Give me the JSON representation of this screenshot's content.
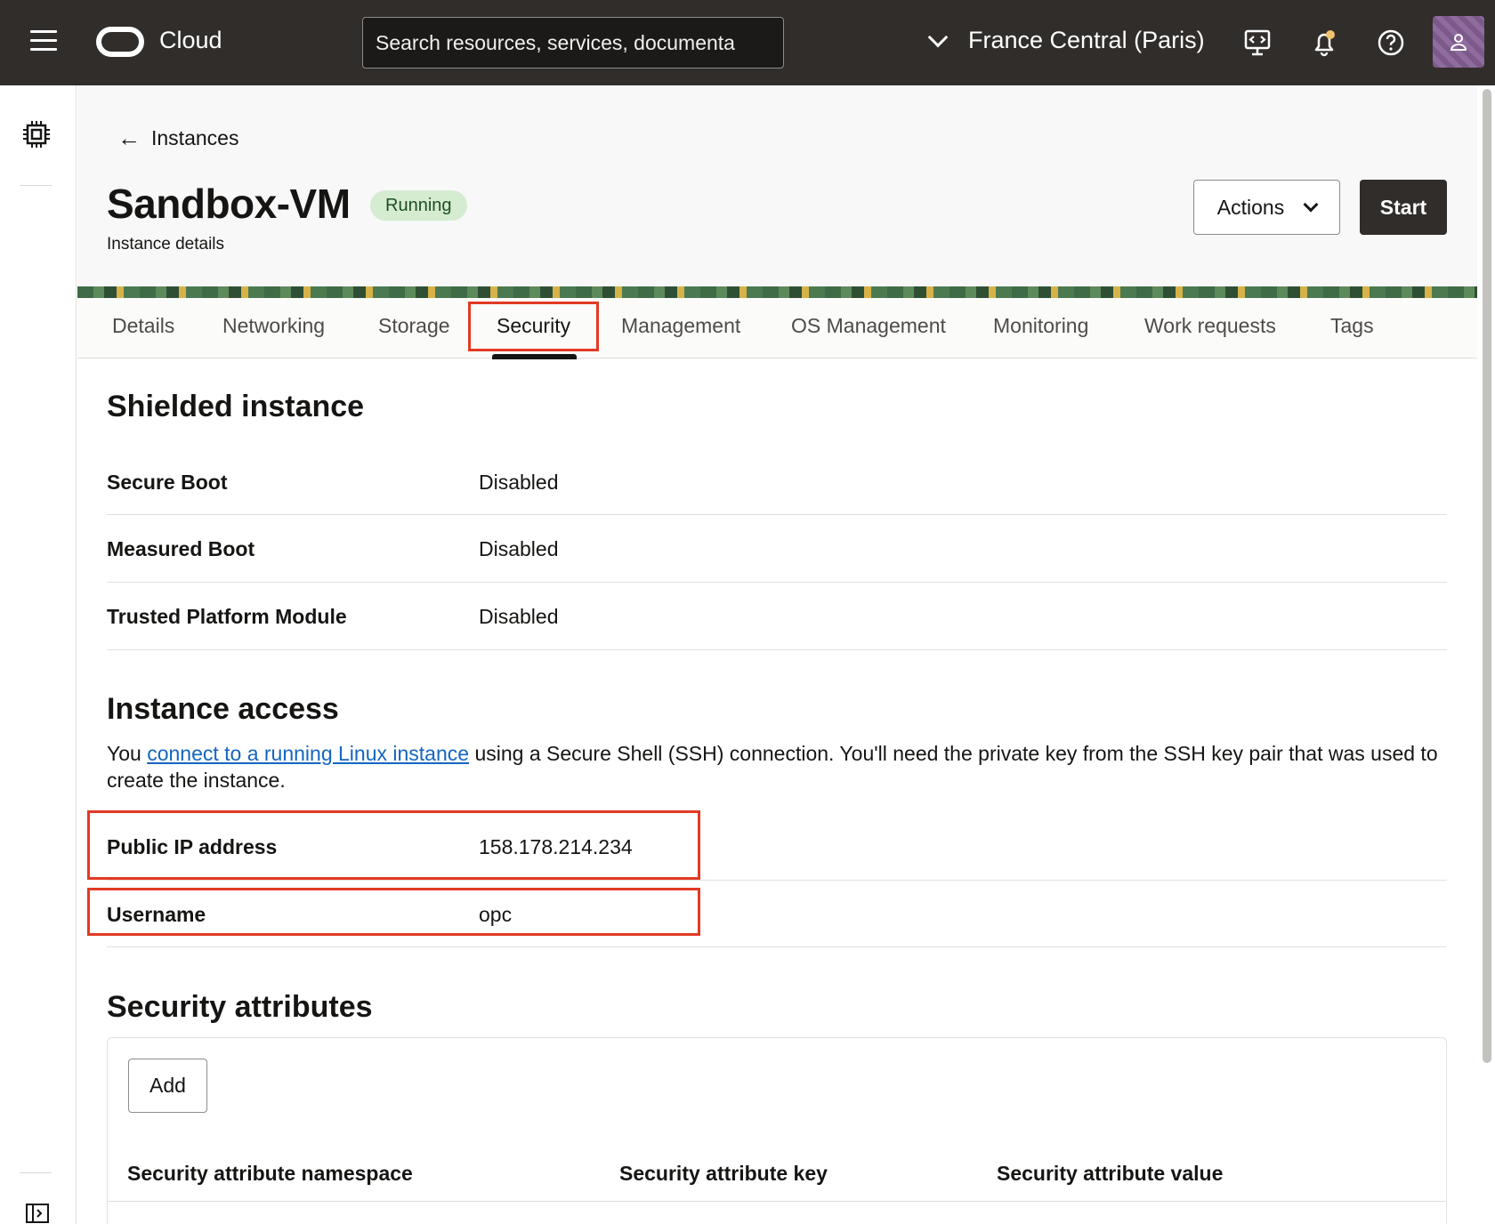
{
  "header": {
    "brand": "Cloud",
    "search_placeholder": "Search resources, services, documenta",
    "region": "France Central (Paris)"
  },
  "breadcrumb": {
    "back_label": "Instances"
  },
  "page": {
    "title": "Sandbox-VM",
    "status": "Running",
    "subtitle": "Instance details",
    "actions_label": "Actions",
    "start_label": "Start"
  },
  "tabs": [
    {
      "label": "Details"
    },
    {
      "label": "Networking"
    },
    {
      "label": "Storage"
    },
    {
      "label": "Security"
    },
    {
      "label": "Management"
    },
    {
      "label": "OS Management"
    },
    {
      "label": "Monitoring"
    },
    {
      "label": "Work requests"
    },
    {
      "label": "Tags"
    }
  ],
  "shielded": {
    "heading": "Shielded instance",
    "rows": [
      {
        "label": "Secure Boot",
        "value": "Disabled"
      },
      {
        "label": "Measured Boot",
        "value": "Disabled"
      },
      {
        "label": "Trusted Platform Module",
        "value": "Disabled"
      }
    ]
  },
  "access": {
    "heading": "Instance access",
    "text_before": "You ",
    "link": "connect to a running Linux instance",
    "text_after": " using a Secure Shell (SSH) connection. You'll need the private key from the SSH key pair that was used to create the instance.",
    "rows": [
      {
        "label": "Public IP address",
        "value": "158.178.214.234"
      },
      {
        "label": "Username",
        "value": "opc"
      }
    ]
  },
  "security_attributes": {
    "heading": "Security attributes",
    "add_label": "Add",
    "columns": [
      "Security attribute namespace",
      "Security attribute key",
      "Security attribute value"
    ]
  },
  "colors": {
    "header_bg": "#312d2a",
    "highlight": "#e23a24",
    "link": "#1565c0",
    "status_badge_bg": "#d5ecd0"
  }
}
